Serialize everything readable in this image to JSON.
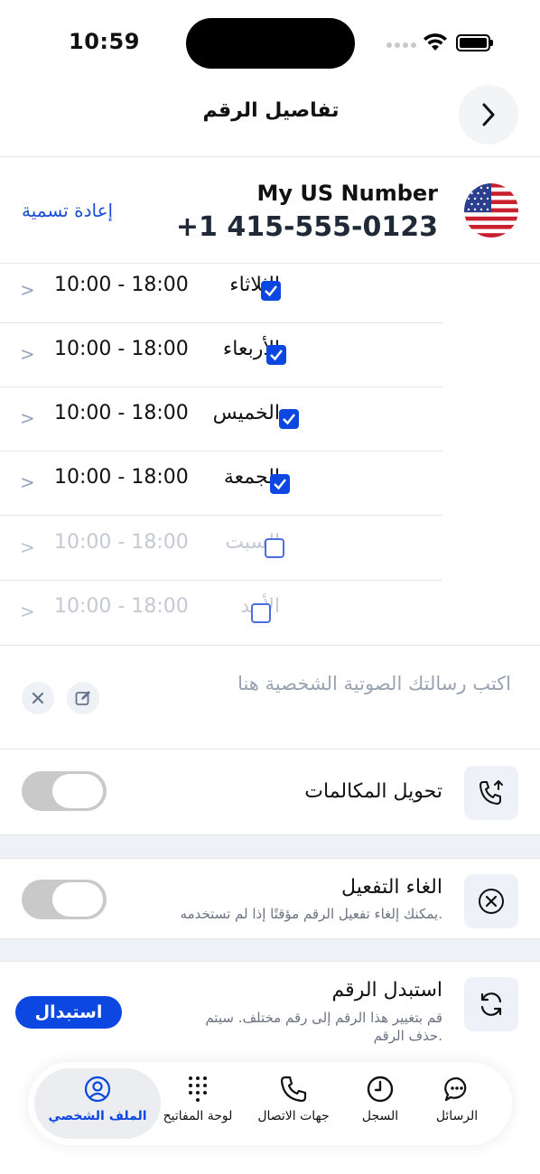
{
  "status": {
    "time": "10:59"
  },
  "header": {
    "title": "تفاصيل الرقم"
  },
  "number": {
    "name": "My US Number",
    "phone": "+1 415-555-0123",
    "rename_label": "إعادة تسمية"
  },
  "schedule": [
    {
      "day": "الثلاثاء",
      "hours": "10:00 - 18:00",
      "enabled": true
    },
    {
      "day": "الأربعاء",
      "hours": "10:00 - 18:00",
      "enabled": true
    },
    {
      "day": "الخميس",
      "hours": "10:00 - 18:00",
      "enabled": true
    },
    {
      "day": "الجمعة",
      "hours": "10:00 - 18:00",
      "enabled": true
    },
    {
      "day": "السبت",
      "hours": "10:00 - 18:00",
      "enabled": false
    },
    {
      "day": "الأحد",
      "hours": "10:00 - 18:00",
      "enabled": false
    }
  ],
  "voicemail": {
    "placeholder": "اكتب رسالتك الصوتية الشخصية هنا"
  },
  "call_forwarding": {
    "title": "تحويل المكالمات",
    "enabled": false
  },
  "deactivate": {
    "title": "الغاء التفعيل",
    "subtitle": "يمكنك إلغاء تفعيل الرقم مؤقتًا إذا لم تستخدمه.",
    "enabled": false
  },
  "replace": {
    "title": "استبدل الرقم",
    "subtitle": "قم بتغيير هذا الرقم إلى رقم مختلف. سيتم حذف الرقم.",
    "button_label": "استبدال"
  },
  "nav": {
    "messages": "الرسائل",
    "history": "السجل",
    "contacts": "جهات الاتصال",
    "keypad": "لوحة المفاتيح",
    "profile": "الملف الشخصي"
  },
  "colors": {
    "accent": "#0b47e0",
    "link": "#1a4fd6",
    "toggle_off": "#c9c9c9"
  }
}
